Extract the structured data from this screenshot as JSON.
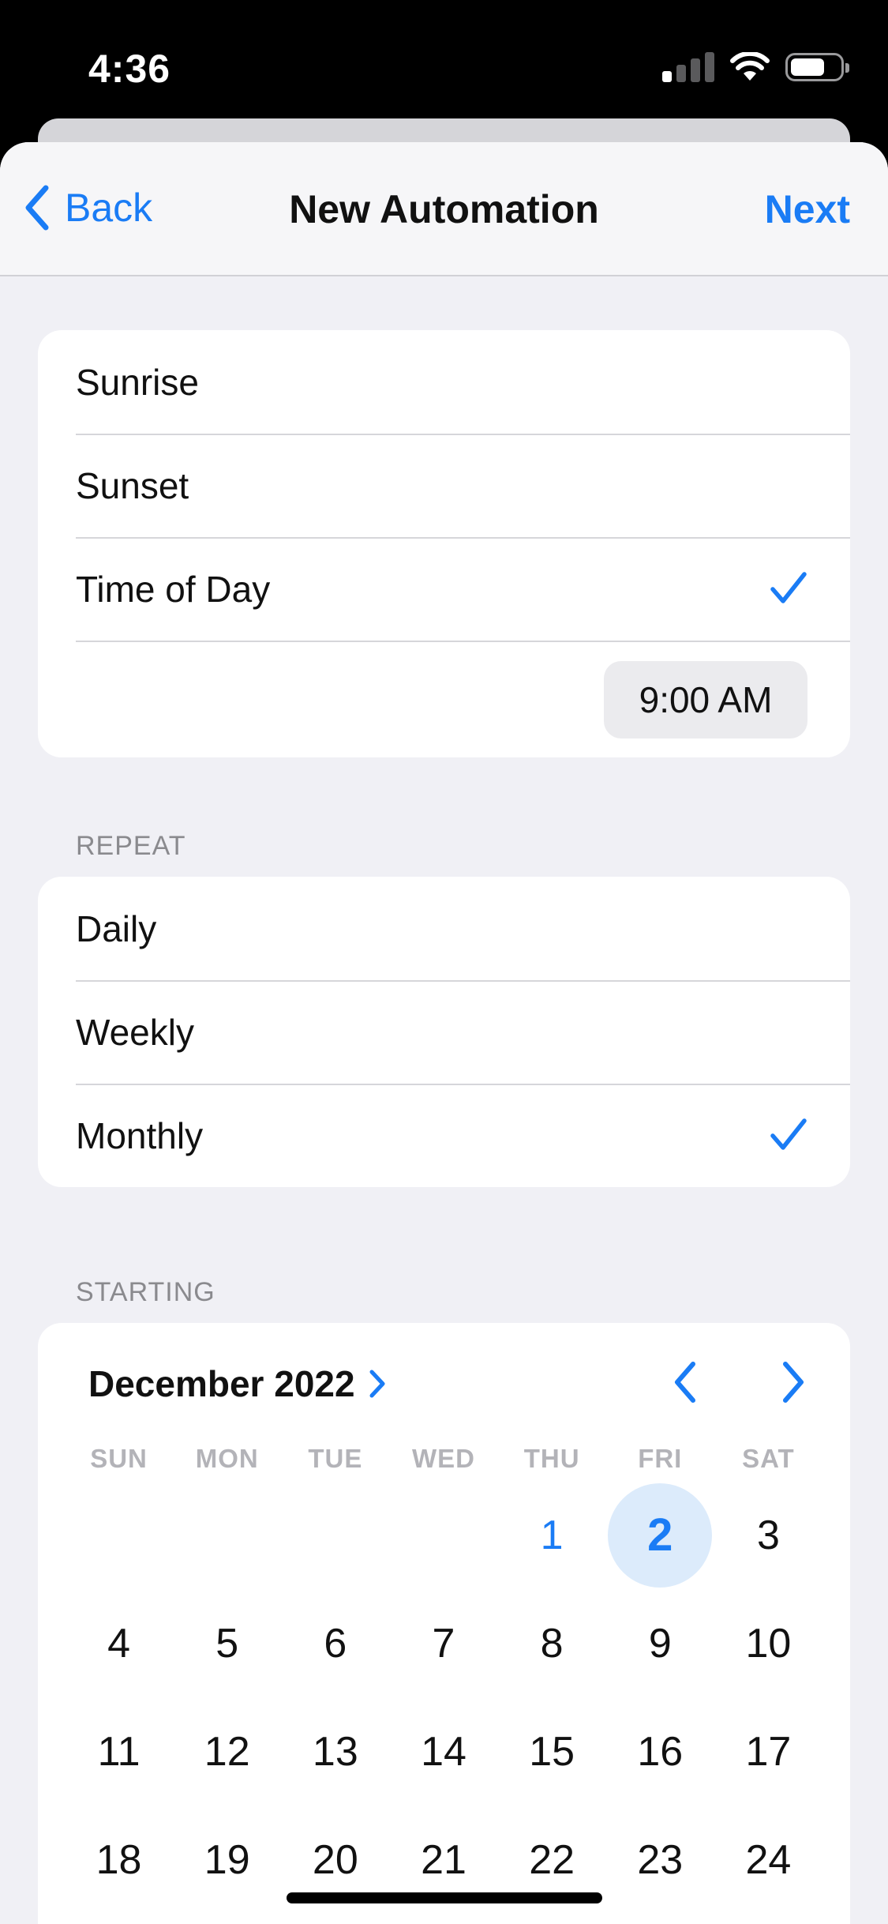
{
  "status_bar": {
    "time": "4:36"
  },
  "nav": {
    "back_label": "Back",
    "title": "New Automation",
    "next_label": "Next"
  },
  "trigger_options": [
    {
      "label": "Sunrise",
      "checked": false
    },
    {
      "label": "Sunset",
      "checked": false
    },
    {
      "label": "Time of Day",
      "checked": true
    }
  ],
  "time_value": "9:00 AM",
  "repeat": {
    "header": "REPEAT",
    "options": [
      {
        "label": "Daily",
        "checked": false
      },
      {
        "label": "Weekly",
        "checked": false
      },
      {
        "label": "Monthly",
        "checked": true
      }
    ]
  },
  "starting": {
    "header": "STARTING",
    "month_label": "December 2022",
    "weekdays": [
      "SUN",
      "MON",
      "TUE",
      "WED",
      "THU",
      "FRI",
      "SAT"
    ],
    "first_weekday_index": 4,
    "visible_days": [
      "1",
      "2",
      "3",
      "4",
      "5",
      "6",
      "7",
      "8",
      "9",
      "10",
      "11",
      "12",
      "13",
      "14",
      "15",
      "16",
      "17",
      "18",
      "19",
      "20",
      "21",
      "22",
      "23",
      "24"
    ],
    "today": "1",
    "selected": "2"
  },
  "colors": {
    "accent": "#1a7cf5",
    "background": "#f0f0f5",
    "selected_day_bg": "#dcebfb"
  }
}
